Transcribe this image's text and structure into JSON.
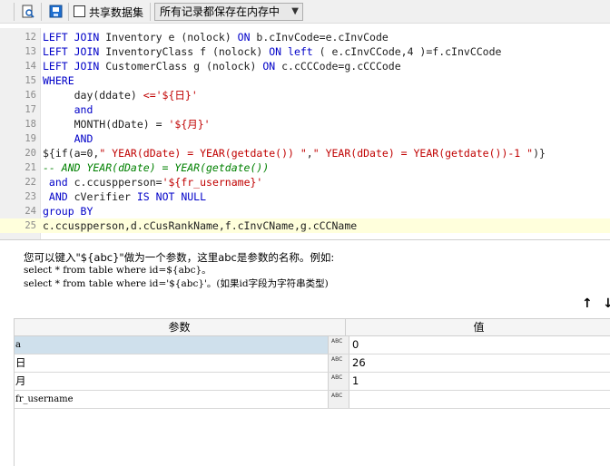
{
  "toolbar": {
    "share_checkbox_label": "共享数据集",
    "storage_select": "所有记录都保存在内存中"
  },
  "editor": {
    "lines": [
      {
        "n": "12",
        "parts": [
          [
            "kw",
            "LEFT JOIN"
          ],
          [
            "ident",
            " Inventory e "
          ],
          [
            "ident",
            "(nolock)"
          ],
          [
            "kw",
            " ON"
          ],
          [
            "ident",
            " b.cInvCode=e.cInvCode"
          ]
        ]
      },
      {
        "n": "13",
        "parts": [
          [
            "kw",
            "LEFT JOIN"
          ],
          [
            "ident",
            " InventoryClass f "
          ],
          [
            "ident",
            "(nolock)"
          ],
          [
            "kw",
            " ON"
          ],
          [
            "kw",
            " left"
          ],
          [
            "ident",
            " ( e.cInvCCode,4 )=f.cInvCCode"
          ]
        ]
      },
      {
        "n": "14",
        "parts": [
          [
            "kw",
            "LEFT JOIN"
          ],
          [
            "ident",
            " CustomerClass g "
          ],
          [
            "ident",
            "(nolock)"
          ],
          [
            "kw",
            " ON"
          ],
          [
            "ident",
            " c.cCCCode=g.cCCCode"
          ]
        ]
      },
      {
        "n": "15",
        "parts": [
          [
            "kw",
            "WHERE"
          ]
        ]
      },
      {
        "n": "16",
        "parts": [
          [
            "ident",
            "     day(ddate) "
          ],
          [
            "str",
            "<='${日}'"
          ]
        ]
      },
      {
        "n": "17",
        "parts": [
          [
            "kw",
            "     and"
          ]
        ]
      },
      {
        "n": "18",
        "parts": [
          [
            "ident",
            "     MONTH(dDate) = "
          ],
          [
            "str",
            "'${月}'"
          ]
        ]
      },
      {
        "n": "19",
        "parts": [
          [
            "kw",
            "     AND"
          ]
        ]
      },
      {
        "n": "20",
        "parts": [
          [
            "ident",
            "${if(a=0,"
          ],
          [
            "str",
            "\" YEAR(dDate) = YEAR(getdate()) \""
          ],
          [
            "ident",
            ","
          ],
          [
            "str",
            "\" YEAR(dDate) = YEAR(getdate())-1 \""
          ],
          [
            "ident",
            ")}"
          ]
        ]
      },
      {
        "n": "21",
        "parts": [
          [
            "cmt",
            "-- AND YEAR(dDate) = YEAR(getdate())"
          ]
        ]
      },
      {
        "n": "22",
        "parts": [
          [
            "kw",
            " and"
          ],
          [
            "ident",
            " c.ccuspperson="
          ],
          [
            "str",
            "'${fr_username}'"
          ]
        ]
      },
      {
        "n": "23",
        "parts": [
          [
            "kw",
            " AND"
          ],
          [
            "ident",
            " cVerifier "
          ],
          [
            "kw",
            "IS NOT NULL"
          ]
        ]
      },
      {
        "n": "24",
        "parts": [
          [
            "kw",
            "group BY"
          ]
        ]
      },
      {
        "n": "25",
        "parts": [
          [
            "ident",
            "c.ccuspperson,d.cCusRankName,f.cInvCName,g.cCCName"
          ]
        ]
      }
    ]
  },
  "hint": {
    "line1": "您可以键入\"${abc}\"做为一个参数，这里abc是参数的名称。例如:",
    "line2": "select * from table where id=${abc}。",
    "line3": "select * from table where id='${abc}'。(如果id字段为字符串类型)"
  },
  "params": {
    "header_param": "参数",
    "header_value": "值",
    "type_icon_text": "ABC",
    "rows": [
      {
        "name": "a",
        "value": "0"
      },
      {
        "name": "日",
        "value": "26"
      },
      {
        "name": "月",
        "value": "1"
      },
      {
        "name": "fr_username",
        "value": ""
      }
    ]
  },
  "arrows": {
    "up": "↑",
    "down": "↓"
  },
  "colors": {
    "keyword": "#0000c8",
    "string": "#c00000",
    "comment": "#008000",
    "highlight_line": "#ffffdc",
    "selected_row": "#cfe0ec"
  }
}
